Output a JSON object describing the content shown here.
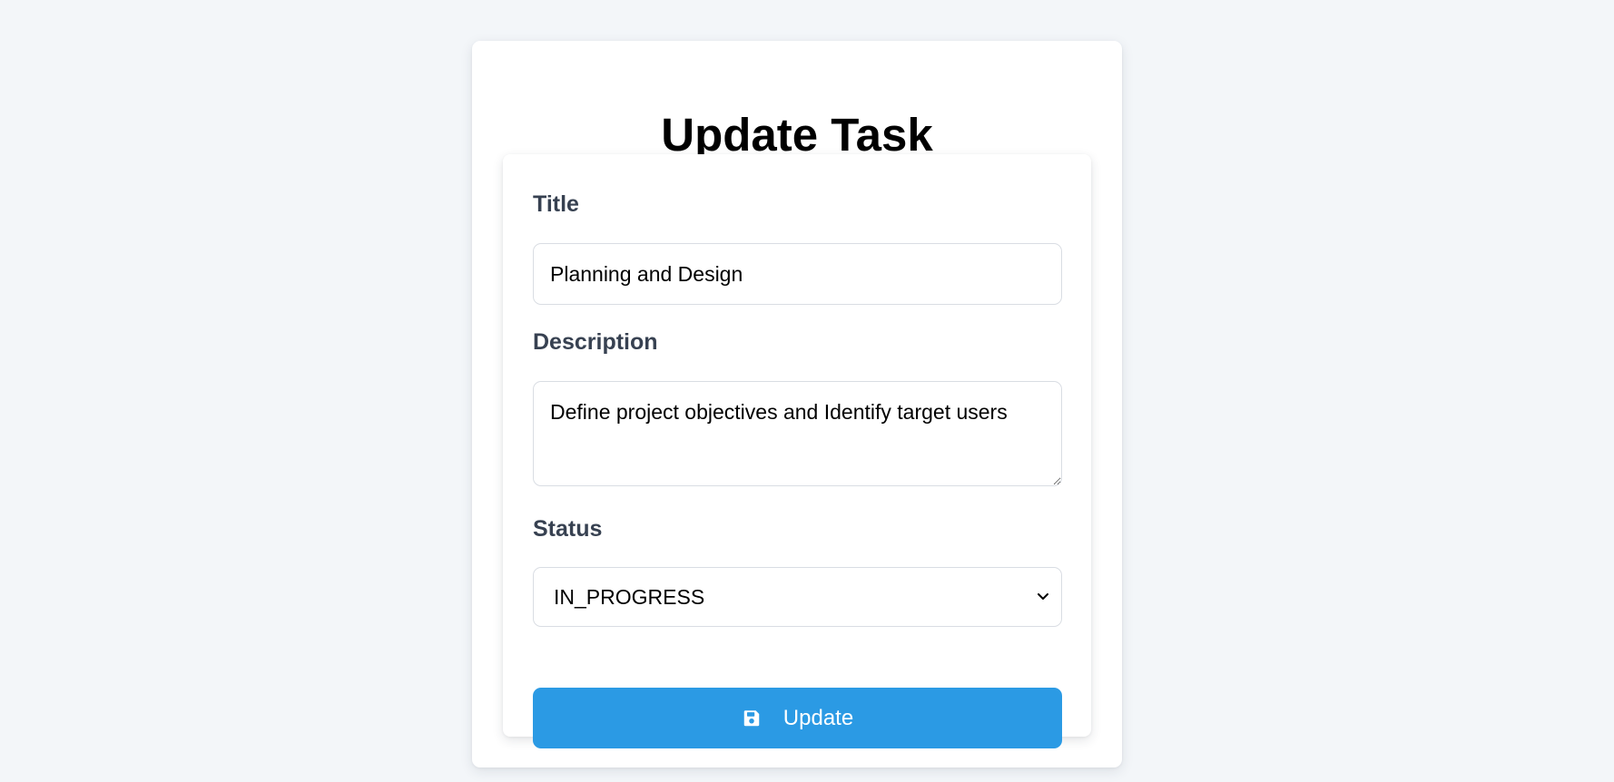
{
  "page": {
    "title": "Update Task"
  },
  "form": {
    "title_label": "Title",
    "title_value": "Planning and Design",
    "description_label": "Description",
    "description_value": "Define project objectives and Identify target users",
    "status_label": "Status",
    "status_value": "IN_PROGRESS",
    "submit_label": "Update"
  },
  "icons": {
    "submit": "save-icon",
    "select": "chevron-down-icon"
  },
  "colors": {
    "background": "#f3f6f9",
    "primary": "#2b9ae4",
    "label": "#374151"
  }
}
